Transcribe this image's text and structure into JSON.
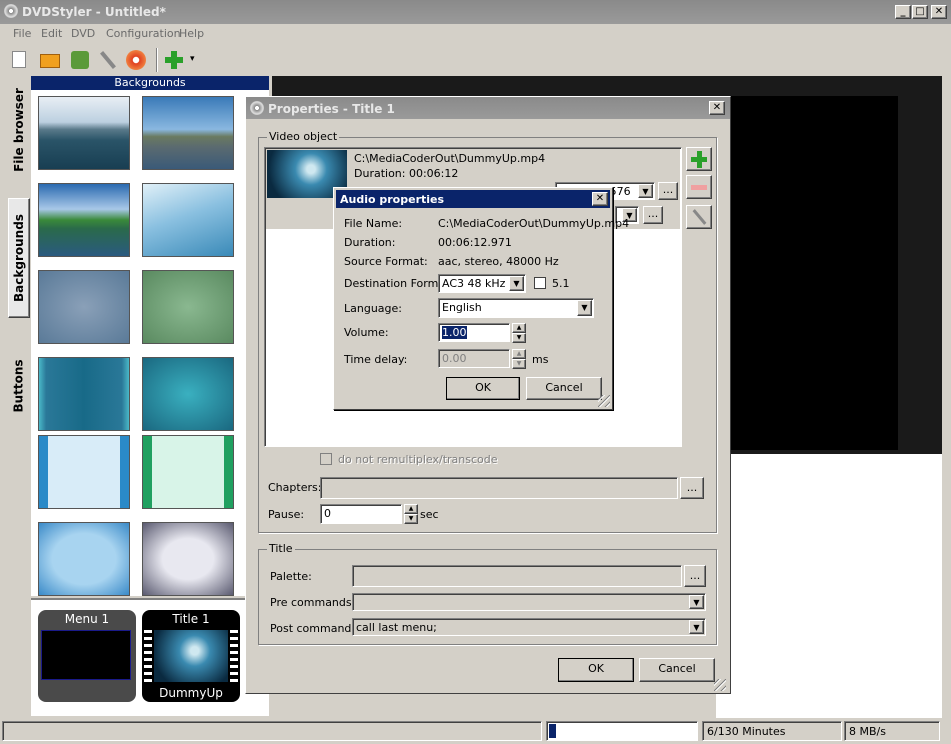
{
  "window": {
    "title": "DVDStyler - Untitled*",
    "min": "_",
    "max": "□",
    "close": "✕"
  },
  "menubar": {
    "items": [
      "File",
      "Edit",
      "DVD",
      "Configuration",
      "Help"
    ]
  },
  "toolbar": {
    "icons": [
      "new-icon",
      "open-icon",
      "save-icon",
      "settings-icon",
      "burn-icon",
      "add-icon"
    ],
    "add_arrow": "▾"
  },
  "sidetabs": [
    "File browser",
    "Backgrounds",
    "Buttons"
  ],
  "backgrounds": {
    "header": "Backgrounds"
  },
  "titleset": {
    "items": [
      {
        "label": "Menu 1",
        "sub": ""
      },
      {
        "label": "Title 1",
        "sub": "DummyUp"
      }
    ]
  },
  "status": {
    "minutes": "6/130 Minutes",
    "rate": "8 MB/s",
    "progress": 0.02
  },
  "properties": {
    "title": "Properties - Title 1",
    "close": "✕",
    "video_group": "Video object",
    "file": "C:\\MediaCoderOut\\DummyUp.mp4",
    "duration": "Duration: 00:06:12",
    "combo1": "PAL 720x576",
    "browse": "...",
    "remux_label": "do not remultiplex/transcode",
    "chapters_label": "Chapters:",
    "chapters_value": "",
    "pause_label": "Pause:",
    "pause_value": "0",
    "pause_unit": "sec",
    "title_group": "Title",
    "palette_label": "Palette:",
    "pre_label": "Pre commands:",
    "pre_value": "",
    "post_label": "Post commands:",
    "post_value": "call last menu;",
    "ok": "OK",
    "cancel": "Cancel"
  },
  "audio": {
    "title": "Audio properties",
    "close": "✕",
    "file_name_label": "File Name:",
    "file_name": "C:\\MediaCoderOut\\DummyUp.mp4",
    "duration_label": "Duration:",
    "duration": "00:06:12.971",
    "source_label": "Source Format:",
    "source": "aac, stereo, 48000 Hz",
    "dest_label": "Destination Format:",
    "dest": "AC3 48 kHz",
    "surround_label": "5.1",
    "language_label": "Language:",
    "language": "English",
    "volume_label": "Volume:",
    "volume": "1.00",
    "delay_label": "Time delay:",
    "delay": "0.00",
    "delay_unit": "ms",
    "ok": "OK",
    "cancel": "Cancel"
  }
}
